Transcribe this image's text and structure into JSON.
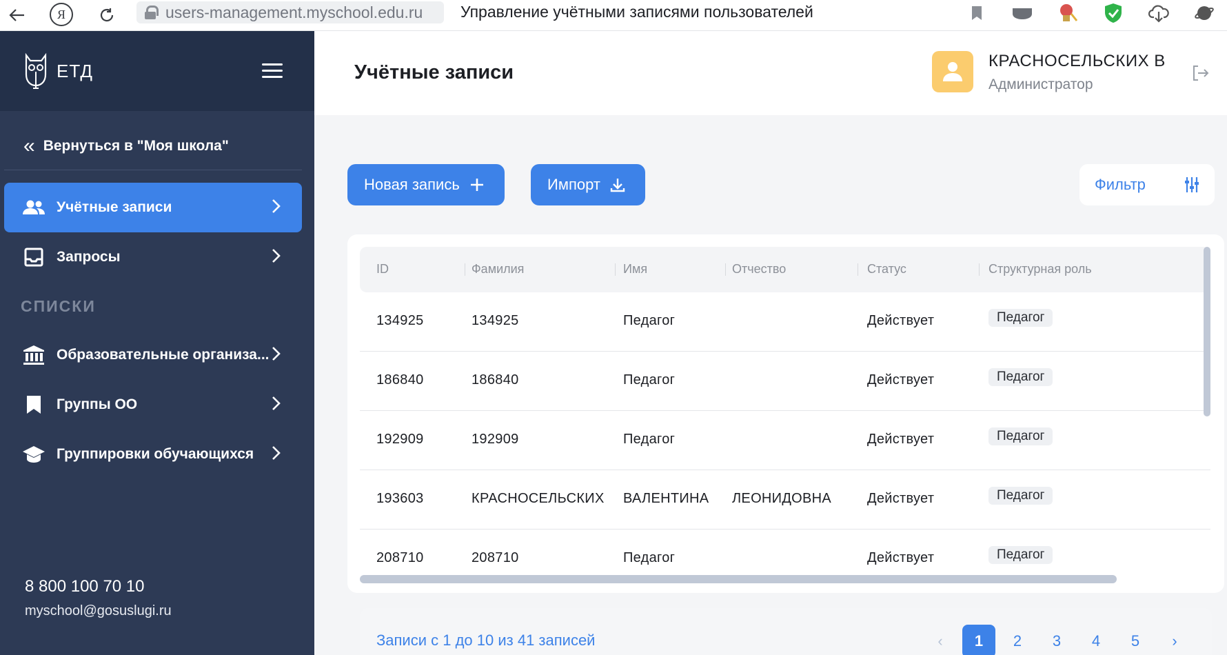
{
  "browser": {
    "url": "users-management.myschool.edu.ru",
    "tab_title": "Управление учётными записями пользователей",
    "search_glyph": "Я",
    "icons": [
      "back-icon",
      "yandex-icon",
      "reload-icon",
      "lock-icon",
      "bookmark-icon",
      "extension-icon",
      "extension-icon",
      "shield-icon",
      "cloud-download-icon",
      "planet-icon"
    ]
  },
  "sidebar": {
    "logo": "ЕТД",
    "back_link": "Вернуться в \"Моя школа\"",
    "items": [
      {
        "label": "Учётные записи",
        "icon": "users-icon"
      },
      {
        "label": "Запросы",
        "icon": "inbox-icon"
      }
    ],
    "section": "СПИСКИ",
    "list_items": [
      {
        "label": "Образовательные организа...",
        "icon": "institution-icon"
      },
      {
        "label": "Группы ОО",
        "icon": "bookmark-icon"
      },
      {
        "label": "Группировки обучающихся",
        "icon": "graduation-cap-icon"
      }
    ],
    "phone": "8 800 100 70 10",
    "email": "myschool@gosuslugi.ru"
  },
  "header": {
    "title": "Учётные записи",
    "user_name": "КРАСНОСЕЛЬСКИХ В",
    "user_role": "Администратор"
  },
  "actions": {
    "new_record": "Новая запись",
    "import": "Импорт",
    "filter": "Фильтр"
  },
  "table": {
    "columns": [
      "ID",
      "Фамилия",
      "Имя",
      "Отчество",
      "Статус",
      "Структурная роль"
    ],
    "rows": [
      [
        "134925",
        "134925",
        "Педагог",
        "",
        "Действует",
        "Педагог"
      ],
      [
        "186840",
        "186840",
        "Педагог",
        "",
        "Действует",
        "Педагог"
      ],
      [
        "192909",
        "192909",
        "Педагог",
        "",
        "Действует",
        "Педагог"
      ],
      [
        "193603",
        "КРАСНОСЕЛЬСКИХ",
        "ВАЛЕНТИНА",
        "ЛЕОНИДОВНА",
        "Действует",
        "Педагог"
      ],
      [
        "208710",
        "208710",
        "Педагог",
        "",
        "Действует",
        "Педагог"
      ]
    ]
  },
  "pagination": {
    "info": "Записи с 1 до 10 из 41 записей",
    "prev": "‹",
    "next": "›",
    "pages": [
      "1",
      "2",
      "3",
      "4",
      "5"
    ],
    "current": "1"
  },
  "colors": {
    "accent": "#3d82e8",
    "sidebar": "#2d3a55",
    "sidebar_header": "#233049",
    "avatar": "#fbcc6e"
  }
}
